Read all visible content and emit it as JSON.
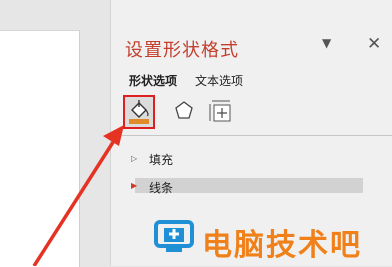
{
  "pane": {
    "title": "设置形状格式",
    "pin_glyph": "▼",
    "close_glyph": "✕",
    "tabs": [
      {
        "label": "形状选项",
        "selected": true
      },
      {
        "label": "文本选项",
        "selected": false
      }
    ],
    "icons": [
      "fill-line-icon",
      "effects-pentagon-icon",
      "size-properties-icon"
    ],
    "sections": [
      {
        "label": "填充",
        "expanded": false
      },
      {
        "label": "线条",
        "expanded": false,
        "highlighted": true
      }
    ]
  },
  "watermark": {
    "text": "电脑技术吧"
  },
  "colors": {
    "title": "#c4402e",
    "highlight_box": "#e02020",
    "arrow": "#e53222",
    "watermark": "#f0811a"
  }
}
